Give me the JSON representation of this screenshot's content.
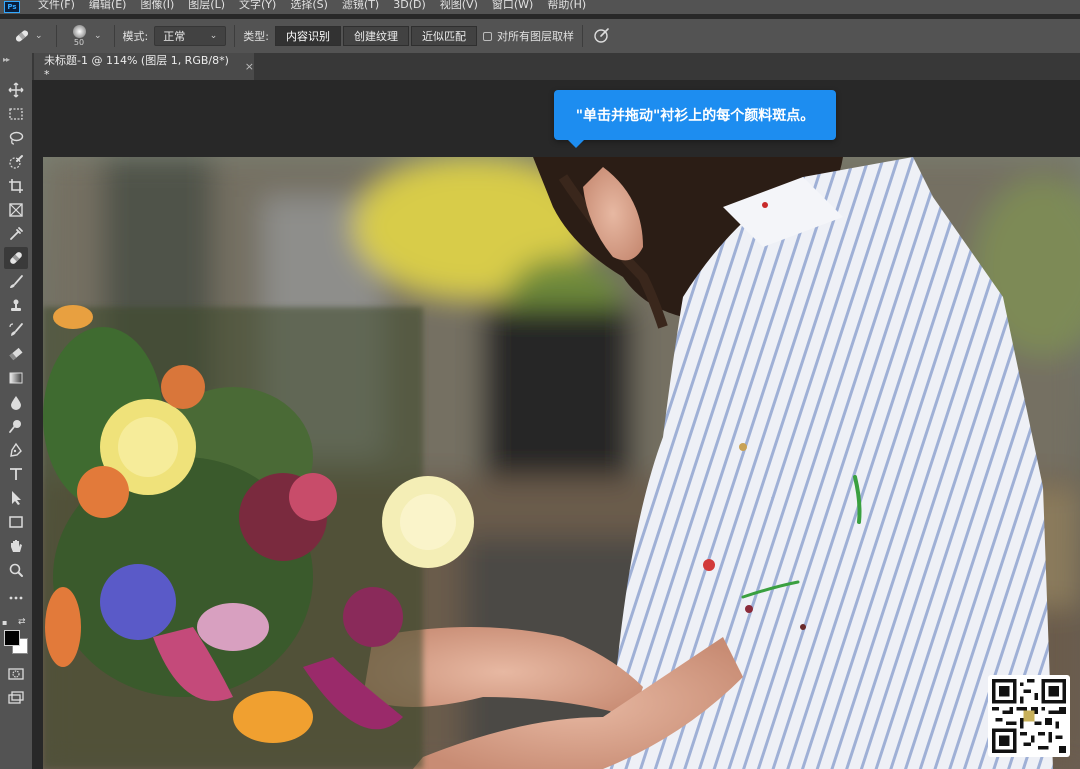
{
  "app": {
    "logo_text": "Ps"
  },
  "menubar": {
    "items": [
      "文件(F)",
      "编辑(E)",
      "图像(I)",
      "图层(L)",
      "文字(Y)",
      "选择(S)",
      "滤镜(T)",
      "3D(D)",
      "视图(V)",
      "窗口(W)",
      "帮助(H)"
    ]
  },
  "options": {
    "tool_icon": "spot-healing-brush-icon",
    "brush_size": "50",
    "mode_label": "模式:",
    "mode_value": "正常",
    "type_label": "类型:",
    "type_options": [
      "内容识别",
      "创建纹理",
      "近似匹配"
    ],
    "type_selected": "内容识别",
    "sample_all_layers_label": "对所有图层取样",
    "sample_all_layers_checked": false,
    "pressure_icon": "pressure-size-icon"
  },
  "document": {
    "tab_title": "未标题-1 @ 114% (图层 1, RGB/8*) *",
    "close_glyph": "×"
  },
  "tooltip": {
    "text": "\"单击并拖动\"衬衫上的每个颜料斑点。"
  },
  "toolbar": {
    "tools": [
      "move-icon",
      "marquee-icon",
      "lasso-icon",
      "quick-selection-icon",
      "crop-icon",
      "frame-icon",
      "eyedropper-icon",
      "spot-healing-brush-icon",
      "brush-icon",
      "clone-stamp-icon",
      "history-brush-icon",
      "eraser-icon",
      "gradient-icon",
      "blur-icon",
      "dodge-icon",
      "pen-icon",
      "type-icon",
      "path-selection-icon",
      "rectangle-icon",
      "hand-icon",
      "zoom-icon",
      "more-tools-icon"
    ],
    "active_tool": "spot-healing-brush-icon",
    "foreground_color": "#000000",
    "background_color": "#ffffff"
  },
  "colors": {
    "accent": "#1d8df0",
    "panel": "#535353",
    "workspace": "#282828"
  }
}
